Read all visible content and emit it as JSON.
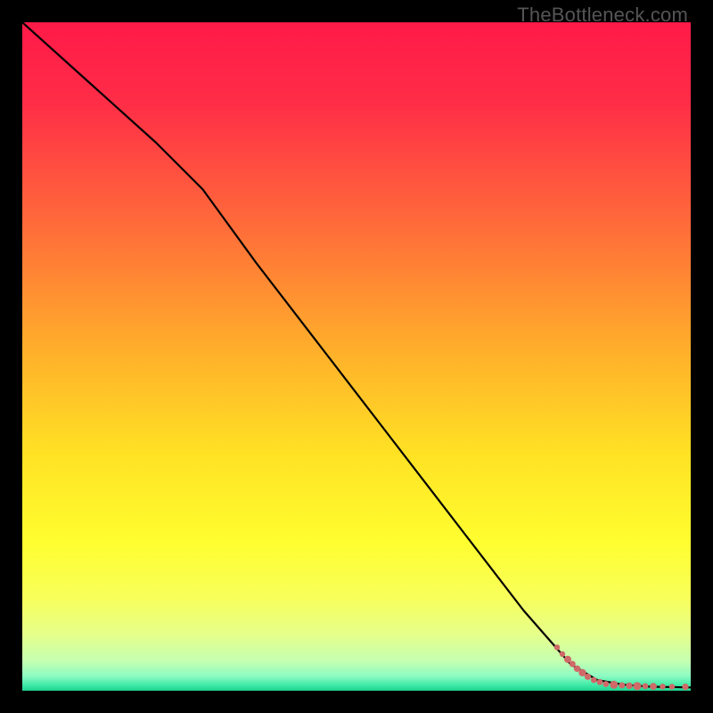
{
  "watermark": "TheBottleneck.com",
  "colors": {
    "line": "#000000",
    "scatter_fill": "#cf6a68",
    "scatter_stroke": "#cf6a68",
    "gradient_stops": [
      {
        "offset": 0.0,
        "color": "#ff1a48"
      },
      {
        "offset": 0.12,
        "color": "#ff2d47"
      },
      {
        "offset": 0.3,
        "color": "#ff6a3a"
      },
      {
        "offset": 0.5,
        "color": "#ffb22a"
      },
      {
        "offset": 0.65,
        "color": "#ffe324"
      },
      {
        "offset": 0.78,
        "color": "#fffe30"
      },
      {
        "offset": 0.86,
        "color": "#f8ff5a"
      },
      {
        "offset": 0.915,
        "color": "#e6ff8a"
      },
      {
        "offset": 0.955,
        "color": "#c6ffb0"
      },
      {
        "offset": 0.978,
        "color": "#8dfbc2"
      },
      {
        "offset": 0.992,
        "color": "#3de9a6"
      },
      {
        "offset": 1.0,
        "color": "#1fd28f"
      }
    ]
  },
  "chart_data": {
    "type": "line",
    "title": "",
    "xlabel": "",
    "ylabel": "",
    "xlim": [
      0,
      100
    ],
    "ylim": [
      0,
      100
    ],
    "series": [
      {
        "name": "curve",
        "kind": "line",
        "x": [
          0,
          10,
          20,
          27,
          35,
          45,
          55,
          65,
          75,
          82,
          86,
          90,
          94,
          100
        ],
        "y": [
          100,
          91,
          82,
          75,
          64,
          51,
          38,
          25,
          12,
          4,
          1.6,
          0.9,
          0.6,
          0.5
        ]
      },
      {
        "name": "scatter-tail",
        "kind": "scatter",
        "points": [
          {
            "x": 80.0,
            "y": 6.5,
            "r": 3.2
          },
          {
            "x": 80.8,
            "y": 5.5,
            "r": 3.2
          },
          {
            "x": 81.6,
            "y": 4.7,
            "r": 4.0
          },
          {
            "x": 82.3,
            "y": 4.0,
            "r": 3.5
          },
          {
            "x": 83.0,
            "y": 3.3,
            "r": 3.7
          },
          {
            "x": 83.8,
            "y": 2.7,
            "r": 4.2
          },
          {
            "x": 84.6,
            "y": 2.1,
            "r": 3.6
          },
          {
            "x": 85.5,
            "y": 1.6,
            "r": 3.4
          },
          {
            "x": 86.4,
            "y": 1.3,
            "r": 3.4
          },
          {
            "x": 87.3,
            "y": 1.0,
            "r": 3.4
          },
          {
            "x": 88.5,
            "y": 0.9,
            "r": 4.5
          },
          {
            "x": 89.7,
            "y": 0.8,
            "r": 3.5
          },
          {
            "x": 90.8,
            "y": 0.75,
            "r": 3.7
          },
          {
            "x": 92.0,
            "y": 0.7,
            "r": 4.6
          },
          {
            "x": 93.2,
            "y": 0.68,
            "r": 3.4
          },
          {
            "x": 94.4,
            "y": 0.65,
            "r": 3.9
          },
          {
            "x": 95.8,
            "y": 0.63,
            "r": 3.2
          },
          {
            "x": 97.2,
            "y": 0.6,
            "r": 3.2
          },
          {
            "x": 99.2,
            "y": 0.58,
            "r": 3.6
          }
        ]
      }
    ]
  }
}
